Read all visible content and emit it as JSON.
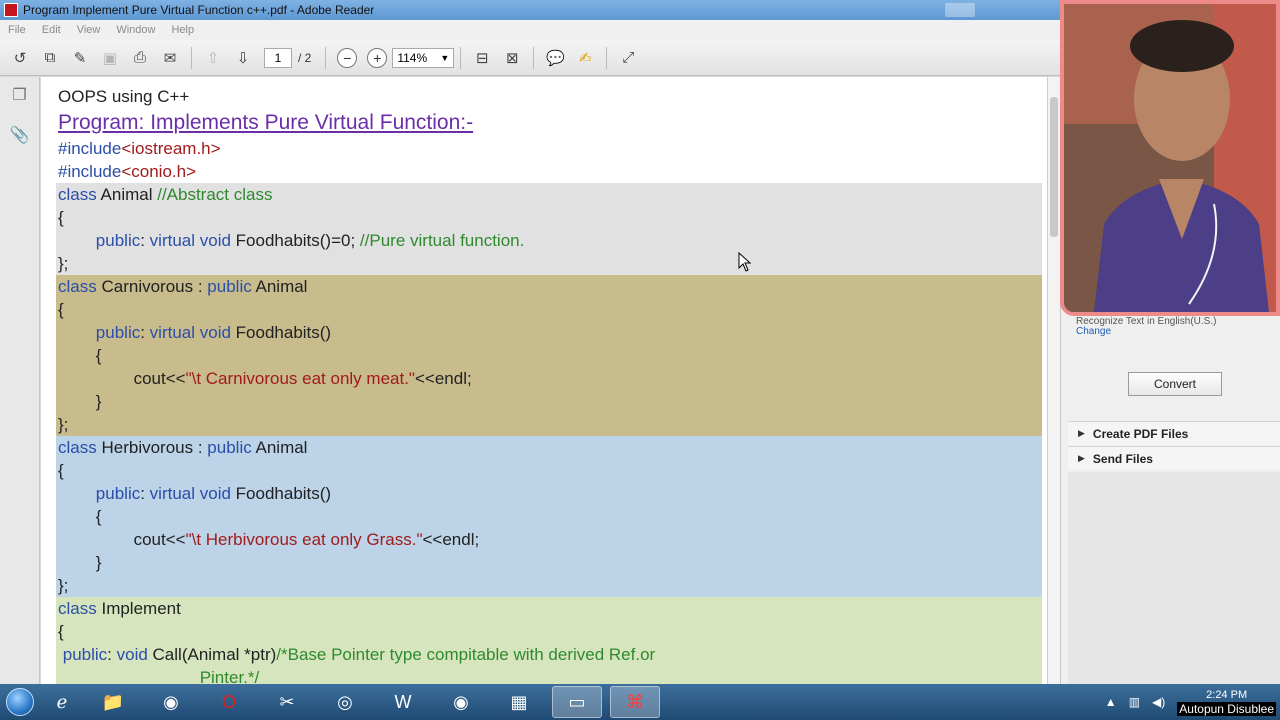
{
  "window": {
    "title": "Program Implement Pure Virtual Function c++.pdf - Adobe Reader"
  },
  "menu": [
    "File",
    "Edit",
    "View",
    "Window",
    "Help"
  ],
  "toolbar": {
    "page_current": "1",
    "page_total": "/ 2",
    "zoom": "114%"
  },
  "doc": {
    "header": "OOPS using C++",
    "title": "Program: Implements Pure Virtual Function:-",
    "lines": [
      {
        "block": "none",
        "parts": [
          [
            "inc",
            "#include"
          ],
          [
            "str",
            "<iostream.h>"
          ]
        ]
      },
      {
        "block": "none",
        "parts": [
          [
            "inc",
            "#include"
          ],
          [
            "str",
            "<conio.h>"
          ]
        ]
      },
      {
        "block": "gray",
        "parts": [
          [
            "kw",
            "class "
          ],
          [
            "txt",
            "Animal "
          ],
          [
            "cmt",
            "//Abstract class"
          ]
        ]
      },
      {
        "block": "gray",
        "parts": [
          [
            "txt",
            "{"
          ]
        ]
      },
      {
        "block": "gray",
        "parts": [
          [
            "txt",
            "        "
          ],
          [
            "kw",
            "public"
          ],
          [
            "txt",
            ": "
          ],
          [
            "kw",
            "virtual void "
          ],
          [
            "txt",
            "Foodhabits()=0; "
          ],
          [
            "cmt",
            "//Pure virtual function."
          ]
        ]
      },
      {
        "block": "gray",
        "parts": [
          [
            "txt",
            "};"
          ]
        ]
      },
      {
        "block": "olive",
        "parts": [
          [
            "kw",
            "class "
          ],
          [
            "txt",
            "Carnivorous : "
          ],
          [
            "kw",
            "public "
          ],
          [
            "txt",
            "Animal"
          ]
        ]
      },
      {
        "block": "olive",
        "parts": [
          [
            "txt",
            "{"
          ]
        ]
      },
      {
        "block": "olive",
        "parts": [
          [
            "txt",
            "        "
          ],
          [
            "kw",
            "public"
          ],
          [
            "txt",
            ": "
          ],
          [
            "kw",
            "virtual void "
          ],
          [
            "txt",
            "Foodhabits()"
          ]
        ]
      },
      {
        "block": "olive",
        "parts": [
          [
            "txt",
            "        {"
          ]
        ]
      },
      {
        "block": "olive",
        "parts": [
          [
            "txt",
            "                cout<<"
          ],
          [
            "str",
            "\"\\t Carnivorous eat only meat.\""
          ],
          [
            "txt",
            "<<endl;"
          ]
        ]
      },
      {
        "block": "olive",
        "parts": [
          [
            "txt",
            "        }"
          ]
        ]
      },
      {
        "block": "olive",
        "parts": [
          [
            "txt",
            "};"
          ]
        ]
      },
      {
        "block": "blue",
        "parts": [
          [
            "kw",
            "class "
          ],
          [
            "txt",
            "Herbivorous : "
          ],
          [
            "kw",
            "public "
          ],
          [
            "txt",
            "Animal"
          ]
        ]
      },
      {
        "block": "blue",
        "parts": [
          [
            "txt",
            "{"
          ]
        ]
      },
      {
        "block": "blue",
        "parts": [
          [
            "txt",
            "        "
          ],
          [
            "kw",
            "public"
          ],
          [
            "txt",
            ": "
          ],
          [
            "kw",
            "virtual void "
          ],
          [
            "txt",
            "Foodhabits()"
          ]
        ]
      },
      {
        "block": "blue",
        "parts": [
          [
            "txt",
            "        {"
          ]
        ]
      },
      {
        "block": "blue",
        "parts": [
          [
            "txt",
            "                cout<<"
          ],
          [
            "str",
            "\"\\t Herbivorous eat only Grass.\""
          ],
          [
            "txt",
            "<<endl;"
          ]
        ]
      },
      {
        "block": "blue",
        "parts": [
          [
            "txt",
            "        }"
          ]
        ]
      },
      {
        "block": "blue",
        "parts": [
          [
            "txt",
            "};"
          ]
        ]
      },
      {
        "block": "green",
        "parts": [
          [
            "kw",
            "class "
          ],
          [
            "txt",
            "Implement"
          ]
        ]
      },
      {
        "block": "green",
        "parts": [
          [
            "txt",
            "{"
          ]
        ]
      },
      {
        "block": "green",
        "parts": [
          [
            "txt",
            " "
          ],
          [
            "kw",
            "public"
          ],
          [
            "txt",
            ": "
          ],
          [
            "kw",
            "void "
          ],
          [
            "txt",
            "Call(Animal *ptr)"
          ],
          [
            "cmt",
            "/*Base Pointer type compitable with derived Ref.or"
          ]
        ]
      },
      {
        "block": "green",
        "parts": [
          [
            "cmt",
            "                              Pinter.*/"
          ]
        ]
      }
    ]
  },
  "right_pane": {
    "recognize_text": "Recognize Text in English(U.S.)",
    "change_link": "Change",
    "convert_button": "Convert",
    "panels": [
      "Create PDF Files",
      "Send Files"
    ]
  },
  "taskbar": {
    "apps": [
      "ie-icon",
      "explorer-icon",
      "chrome-icon",
      "opera-icon",
      "tool-icon",
      "media-icon",
      "word-icon",
      "chrome2-icon",
      "film-icon",
      "app-icon",
      "acrobat-icon"
    ],
    "clock": "2:24 PM",
    "overlay_text": "Autopun Disublee"
  }
}
